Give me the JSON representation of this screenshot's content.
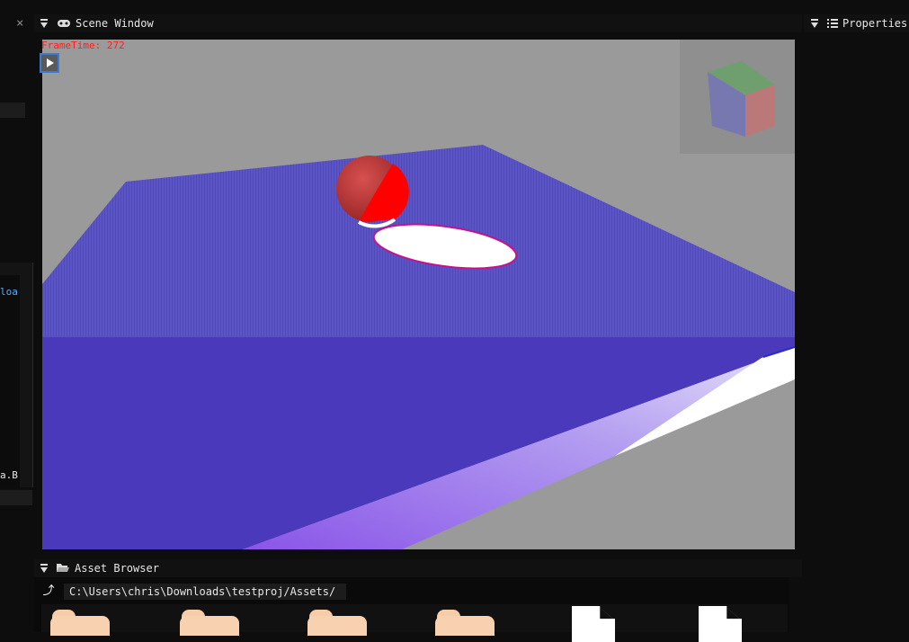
{
  "left_panel": {
    "close_glyph": "×",
    "text_1": "loa",
    "text_2": "a.B"
  },
  "scene_window": {
    "title": "Scene Window",
    "frametime": "FrameTime: 272",
    "play_label": "▶"
  },
  "properties": {
    "title": "Properties"
  },
  "asset_browser": {
    "title": "Asset Browser",
    "up_glyph": "⤴",
    "path": "C:\\Users\\chris\\Downloads\\testproj/Assets/",
    "items": [
      {
        "type": "folder"
      },
      {
        "type": "folder"
      },
      {
        "type": "folder"
      },
      {
        "type": "folder"
      },
      {
        "type": "file"
      },
      {
        "type": "file"
      }
    ]
  },
  "colors": {
    "plane": "#5a50c2",
    "sphere": "#c03a3a",
    "folder": "#f8d2b0",
    "frametime": "#ff2020",
    "accent": "#3d7ad1"
  },
  "icons": {
    "collapse": "collapse-triangle-icon",
    "scene": "gamepad-icon",
    "properties": "list-icon",
    "asset_browser": "folder-open-icon"
  }
}
